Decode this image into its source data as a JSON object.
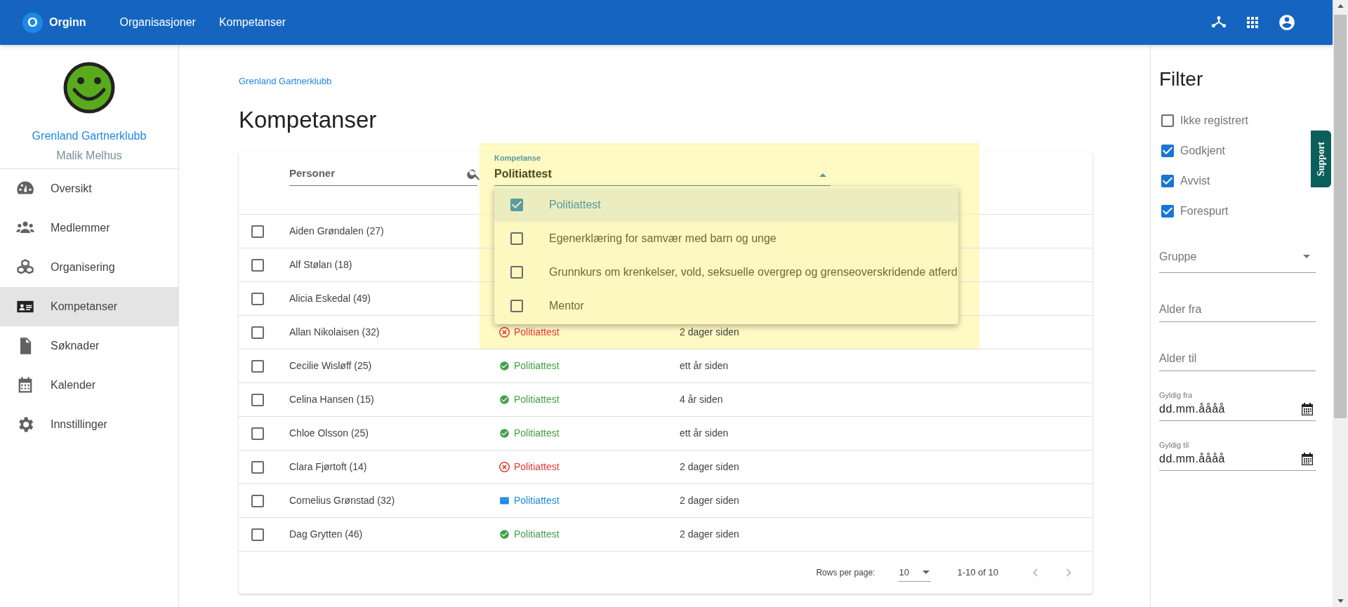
{
  "app": {
    "logo_letter": "O",
    "name": "Orginn"
  },
  "top_nav": [
    {
      "label": "Organisasjoner"
    },
    {
      "label": "Kompetanser"
    }
  ],
  "sidebar": {
    "organization": "Grenland Gartnerklubb",
    "user": "Malik Melhus",
    "items": [
      {
        "label": "Oversikt",
        "kind": "gauge",
        "selected": false
      },
      {
        "label": "Medlemmer",
        "kind": "people",
        "selected": false
      },
      {
        "label": "Organisering",
        "kind": "cubes",
        "selected": false
      },
      {
        "label": "Kompetanser",
        "kind": "card",
        "selected": true
      },
      {
        "label": "Søknader",
        "kind": "document",
        "selected": false
      },
      {
        "label": "Kalender",
        "kind": "calendar",
        "selected": false
      },
      {
        "label": "Innstillinger",
        "kind": "gear",
        "selected": false
      }
    ]
  },
  "breadcrumb": "Grenland Gartnerklubb",
  "title": "Kompetanser",
  "search": {
    "placeholder": "Personer"
  },
  "competence_select": {
    "label": "Kompetanse",
    "value": "Politiattest",
    "expanded": true,
    "options": [
      {
        "label": "Politiattest",
        "checked": true,
        "selected": true
      },
      {
        "label": "Egenerklæring for samvær med barn og unge",
        "checked": false,
        "selected": false
      },
      {
        "label": "Grunnkurs om krenkelser, vold, seksuelle overgrep og grenseoverskridende atferd",
        "checked": false,
        "selected": false
      },
      {
        "label": "Mentor",
        "checked": false,
        "selected": false
      }
    ]
  },
  "rows": [
    {
      "name": "Aiden Grøndalen (27)",
      "checked": false
    },
    {
      "name": "Alf Stølan (18)",
      "checked": false
    },
    {
      "name": "Alicia Eskedal (49)",
      "checked": false
    },
    {
      "name": "Allan Nikolaisen (32)",
      "checked": false,
      "status": {
        "kind": "rejected",
        "label": "Politiattest"
      },
      "time": "2 dager siden"
    },
    {
      "name": "Cecilie Wisløff (25)",
      "checked": false,
      "status": {
        "kind": "approved",
        "label": "Politiattest"
      },
      "time": "ett år siden"
    },
    {
      "name": "Celina Hansen (15)",
      "checked": false,
      "status": {
        "kind": "approved",
        "label": "Politiattest"
      },
      "time": "4 år siden"
    },
    {
      "name": "Chloe Olsson (25)",
      "checked": false,
      "status": {
        "kind": "approved",
        "label": "Politiattest"
      },
      "time": "ett år siden"
    },
    {
      "name": "Clara Fjørtoft (14)",
      "checked": false,
      "status": {
        "kind": "rejected",
        "label": "Politiattest"
      },
      "time": "2 dager siden"
    },
    {
      "name": "Cornelius Grønstad (32)",
      "checked": false,
      "status": {
        "kind": "requested",
        "label": "Politiattest"
      },
      "time": "2 dager siden"
    },
    {
      "name": "Dag Grytten (46)",
      "checked": false,
      "status": {
        "kind": "approved",
        "label": "Politiattest"
      },
      "time": "2 dager siden"
    }
  ],
  "pagination": {
    "rows_per_page_label": "Rows per page:",
    "rows_per_page": "10",
    "range": "1-10 of 10"
  },
  "filter": {
    "title": "Filter",
    "statuses": [
      {
        "label": "Ikke registrert",
        "checked": false
      },
      {
        "label": "Godkjent",
        "checked": true
      },
      {
        "label": "Avvist",
        "checked": true
      },
      {
        "label": "Forespurt",
        "checked": true
      }
    ],
    "group": {
      "label": "Gruppe"
    },
    "age_from": {
      "placeholder": "Alder fra"
    },
    "age_to": {
      "placeholder": "Alder til"
    },
    "valid_from": {
      "label": "Gyldig fra",
      "placeholder": "dd.mm.åååå"
    },
    "valid_to": {
      "label": "Gyldig til",
      "placeholder": "dd.mm.åååå"
    }
  },
  "support_tab": "Support"
}
